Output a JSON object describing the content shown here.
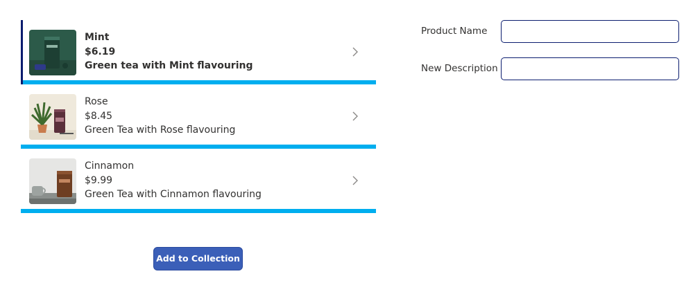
{
  "gallery": {
    "items": [
      {
        "name": "Mint",
        "price": "$6.19",
        "description": "Green tea with Mint flavouring",
        "selected": true,
        "image_icon": "mint-tea-tin-icon"
      },
      {
        "name": "Rose",
        "price": "$8.45",
        "description": "Green Tea with Rose flavouring",
        "selected": false,
        "image_icon": "rose-tea-tin-icon"
      },
      {
        "name": "Cinnamon",
        "price": "$9.99",
        "description": "Green Tea with Cinnamon flavouring",
        "selected": false,
        "image_icon": "cinnamon-tea-tin-icon"
      }
    ],
    "separator_color": "#00aeef",
    "selected_bar_color": "#0a1c6e"
  },
  "actions": {
    "add_label": "Add to Collection"
  },
  "form": {
    "product_name_label": "Product Name",
    "product_name_value": "",
    "description_label": "New Description",
    "description_value": ""
  },
  "colors": {
    "button_bg": "#3b5fb8",
    "input_border": "#0a1c6e"
  }
}
